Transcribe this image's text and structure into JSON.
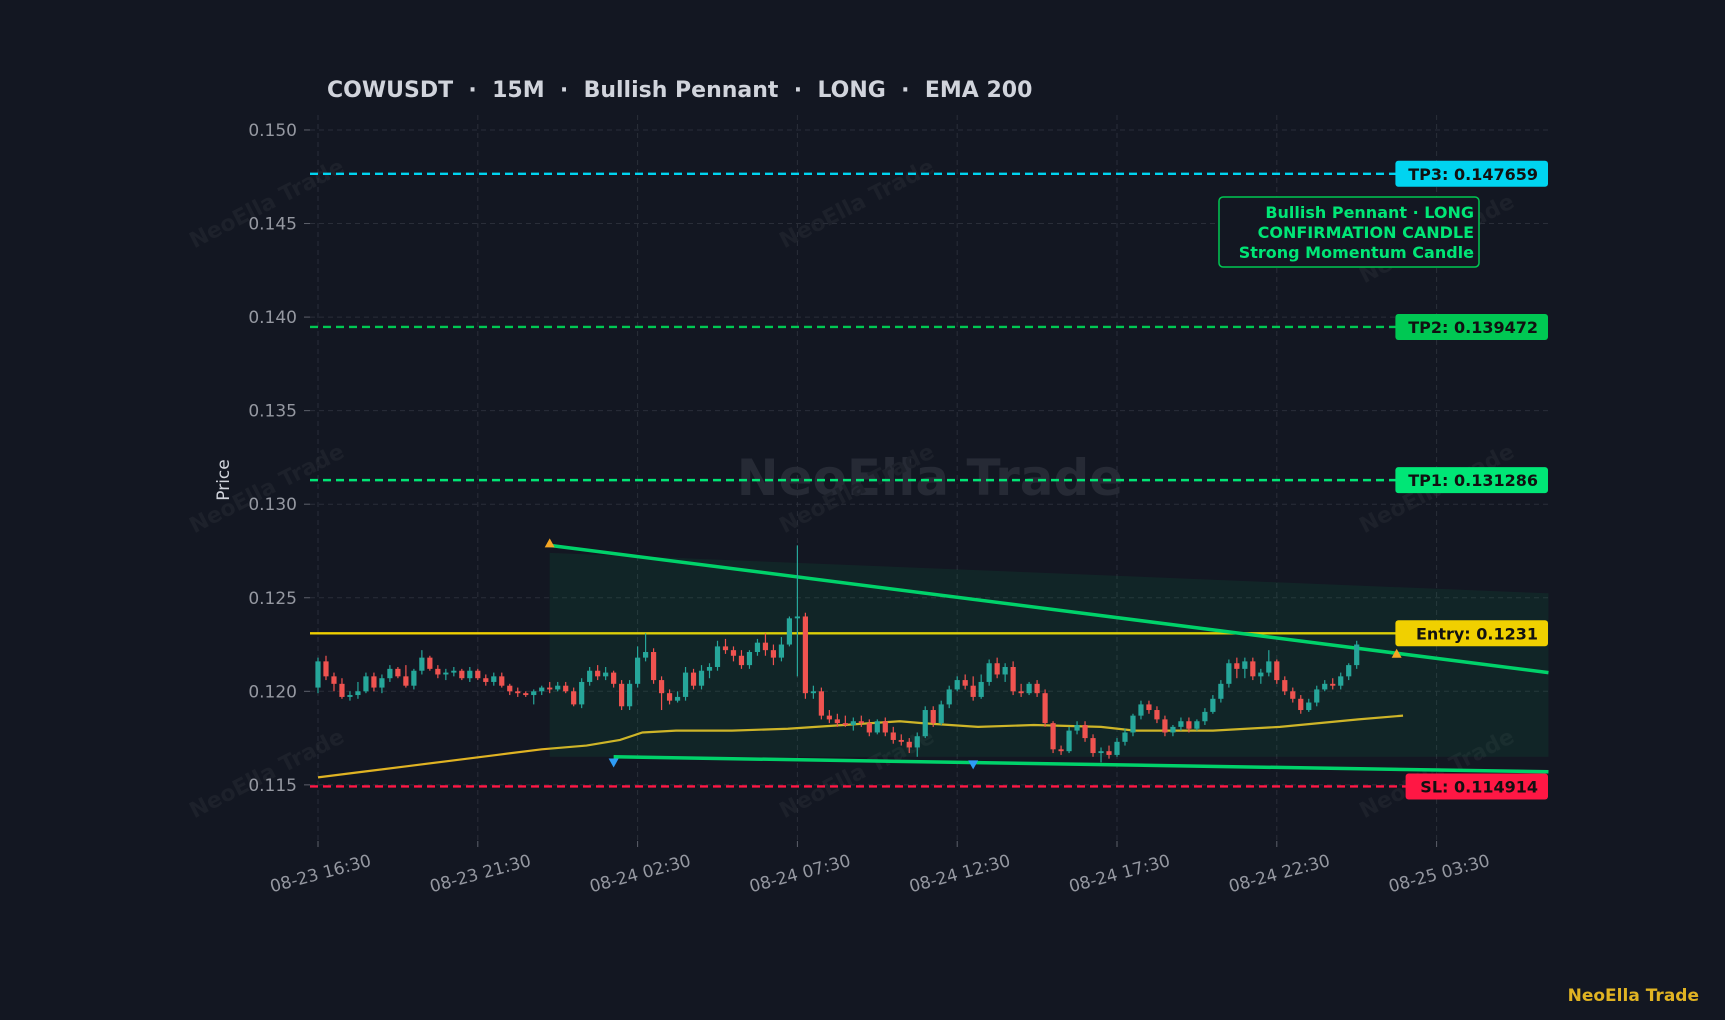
{
  "title": "COWUSDT  ·  15M  ·  Bullish Pennant  ·  LONG  ·  EMA 200",
  "brand": "NeoElla Trade",
  "watermark": "NeoElla Trade",
  "colors": {
    "background": "#131722",
    "grid": "#2a2e39",
    "bull": "#26a69a",
    "bear": "#ef5350",
    "ema": "#e0b323",
    "entry": "#f0d000",
    "tp1": "#00e676",
    "tp2": "#00c853",
    "tp3": "#00d4f0",
    "sl": "#ff1744",
    "pattern": "#00d26a",
    "text": "#9598a1"
  },
  "chart_data": {
    "type": "candlestick",
    "ylabel": "Price",
    "xlabel": "",
    "ylim": [
      0.112,
      0.1508
    ],
    "grid": true,
    "yticks": [
      0.115,
      0.12,
      0.125,
      0.13,
      0.135,
      0.14,
      0.145,
      0.15
    ],
    "xticks": [
      "08-23 16:30",
      "08-23 21:30",
      "08-24 02:30",
      "08-24 07:30",
      "08-24 12:30",
      "08-24 17:30",
      "08-24 22:30",
      "08-25 03:30"
    ],
    "levels": [
      {
        "key": "tp3",
        "label": "TP3: 0.147659",
        "value": 0.147659,
        "style": "dashed"
      },
      {
        "key": "tp2",
        "label": "TP2: 0.139472",
        "value": 0.139472,
        "style": "dashed"
      },
      {
        "key": "tp1",
        "label": "TP1: 0.131286",
        "value": 0.131286,
        "style": "dashed"
      },
      {
        "key": "entry",
        "label": "Entry: 0.1231",
        "value": 0.1231,
        "style": "solid"
      },
      {
        "key": "sl",
        "label": "SL: 0.114914",
        "value": 0.114914,
        "style": "dashed"
      }
    ],
    "annotation": [
      "Bullish Pennant · LONG",
      "CONFIRMATION CANDLE",
      "Strong Momentum Candle"
    ],
    "pattern": {
      "upper": [
        [
          29,
          0.1278
        ],
        [
          154,
          0.121
        ]
      ],
      "lower": [
        [
          37,
          0.1165
        ],
        [
          154,
          0.1157
        ]
      ],
      "zone": [
        [
          29,
          0.1274
        ],
        [
          154,
          0.1165
        ]
      ],
      "pivots": [
        {
          "x": 29,
          "y": 0.1278,
          "type": "high"
        },
        {
          "x": 37,
          "y": 0.1163,
          "type": "low"
        },
        {
          "x": 82,
          "y": 0.1162,
          "type": "low"
        },
        {
          "x": 135,
          "y": 0.1219,
          "type": "high"
        }
      ]
    },
    "ema": [
      [
        0,
        0.1154
      ],
      [
        4,
        0.1157
      ],
      [
        8,
        0.116
      ],
      [
        12,
        0.1163
      ],
      [
        16,
        0.1166
      ],
      [
        20,
        0.1169
      ],
      [
        24,
        0.1171
      ],
      [
        27,
        0.1174
      ],
      [
        29,
        0.1178
      ],
      [
        32,
        0.1179
      ],
      [
        37,
        0.1179
      ],
      [
        42,
        0.118
      ],
      [
        47,
        0.1182
      ],
      [
        52,
        0.1184
      ],
      [
        54,
        0.1183
      ],
      [
        59,
        0.1181
      ],
      [
        64,
        0.1182
      ],
      [
        70,
        0.1181
      ],
      [
        73,
        0.1179
      ],
      [
        80,
        0.1179
      ],
      [
        86,
        0.1181
      ],
      [
        93,
        0.1185
      ],
      [
        97,
        0.1187
      ]
    ],
    "candle_start": "08-23 16:30",
    "candle_interval_minutes": 15,
    "candles": [
      [
        0.1202,
        0.1218,
        0.1199,
        0.1216
      ],
      [
        0.1216,
        0.1219,
        0.1206,
        0.1208
      ],
      [
        0.1208,
        0.121,
        0.12,
        0.1204
      ],
      [
        0.1204,
        0.1207,
        0.1196,
        0.1197
      ],
      [
        0.1197,
        0.12,
        0.1195,
        0.1198
      ],
      [
        0.1198,
        0.1205,
        0.1196,
        0.12
      ],
      [
        0.12,
        0.121,
        0.1199,
        0.1208
      ],
      [
        0.1208,
        0.121,
        0.12,
        0.1202
      ],
      [
        0.1202,
        0.1209,
        0.1199,
        0.1207
      ],
      [
        0.1207,
        0.1214,
        0.1205,
        0.1212
      ],
      [
        0.1212,
        0.1213,
        0.1207,
        0.1208
      ],
      [
        0.1208,
        0.1214,
        0.1202,
        0.1203
      ],
      [
        0.1203,
        0.1212,
        0.1201,
        0.1211
      ],
      [
        0.1211,
        0.1222,
        0.1209,
        0.1218
      ],
      [
        0.1218,
        0.1219,
        0.1211,
        0.1212
      ],
      [
        0.1212,
        0.1214,
        0.1207,
        0.1209
      ],
      [
        0.1209,
        0.1212,
        0.1206,
        0.121
      ],
      [
        0.121,
        0.1213,
        0.1208,
        0.1211
      ],
      [
        0.1211,
        0.1212,
        0.1206,
        0.1207
      ],
      [
        0.1207,
        0.1213,
        0.1205,
        0.1211
      ],
      [
        0.1211,
        0.1212,
        0.1206,
        0.1207
      ],
      [
        0.1207,
        0.1209,
        0.1203,
        0.1205
      ],
      [
        0.1205,
        0.121,
        0.1203,
        0.1208
      ],
      [
        0.1208,
        0.121,
        0.1202,
        0.1203
      ],
      [
        0.1203,
        0.1204,
        0.1198,
        0.12
      ],
      [
        0.12,
        0.1202,
        0.1197,
        0.1199
      ],
      [
        0.1199,
        0.12,
        0.1197,
        0.1198
      ],
      [
        0.1198,
        0.1201,
        0.1193,
        0.12
      ],
      [
        0.12,
        0.1203,
        0.1198,
        0.1202
      ],
      [
        0.1202,
        0.1205,
        0.1199,
        0.1201
      ],
      [
        0.1201,
        0.1205,
        0.12,
        0.1203
      ],
      [
        0.1203,
        0.1205,
        0.1199,
        0.12
      ],
      [
        0.12,
        0.1202,
        0.1192,
        0.1193
      ],
      [
        0.1193,
        0.1207,
        0.1191,
        0.1205
      ],
      [
        0.1205,
        0.1213,
        0.1203,
        0.1211
      ],
      [
        0.1211,
        0.1214,
        0.1206,
        0.1208
      ],
      [
        0.1208,
        0.1213,
        0.1206,
        0.121
      ],
      [
        0.121,
        0.1211,
        0.1202,
        0.1204
      ],
      [
        0.1204,
        0.1206,
        0.119,
        0.1192
      ],
      [
        0.1192,
        0.1206,
        0.119,
        0.1204
      ],
      [
        0.1204,
        0.1224,
        0.1202,
        0.1218
      ],
      [
        0.1218,
        0.1231,
        0.1216,
        0.1221
      ],
      [
        0.1221,
        0.1223,
        0.1204,
        0.1206
      ],
      [
        0.1206,
        0.1208,
        0.119,
        0.1199
      ],
      [
        0.1199,
        0.1201,
        0.1193,
        0.1195
      ],
      [
        0.1195,
        0.12,
        0.1194,
        0.1197
      ],
      [
        0.1197,
        0.1213,
        0.1195,
        0.121
      ],
      [
        0.121,
        0.1212,
        0.1201,
        0.1203
      ],
      [
        0.1203,
        0.1214,
        0.1201,
        0.1211
      ],
      [
        0.1211,
        0.1215,
        0.1207,
        0.1213
      ],
      [
        0.1213,
        0.1227,
        0.1211,
        0.1224
      ],
      [
        0.1224,
        0.1228,
        0.122,
        0.1222
      ],
      [
        0.1222,
        0.1224,
        0.1216,
        0.1219
      ],
      [
        0.1219,
        0.1222,
        0.1212,
        0.1214
      ],
      [
        0.1214,
        0.1222,
        0.1212,
        0.1221
      ],
      [
        0.1221,
        0.1228,
        0.1219,
        0.1226
      ],
      [
        0.1226,
        0.1231,
        0.1219,
        0.1222
      ],
      [
        0.1222,
        0.1225,
        0.1214,
        0.1218
      ],
      [
        0.1218,
        0.1229,
        0.1216,
        0.1225
      ],
      [
        0.1225,
        0.124,
        0.1224,
        0.1239
      ],
      [
        0.1239,
        0.1278,
        0.1208,
        0.124
      ],
      [
        0.124,
        0.1242,
        0.1196,
        0.1199
      ],
      [
        0.1199,
        0.1203,
        0.1196,
        0.12
      ],
      [
        0.12,
        0.1202,
        0.1185,
        0.1187
      ],
      [
        0.1187,
        0.119,
        0.1183,
        0.1185
      ],
      [
        0.1185,
        0.1188,
        0.1181,
        0.1183
      ],
      [
        0.1183,
        0.1187,
        0.1181,
        0.1182
      ],
      [
        0.1182,
        0.1186,
        0.1179,
        0.1184
      ],
      [
        0.1184,
        0.1187,
        0.1181,
        0.1183
      ],
      [
        0.1183,
        0.1185,
        0.1176,
        0.1178
      ],
      [
        0.1178,
        0.1185,
        0.1177,
        0.1184
      ],
      [
        0.1184,
        0.1186,
        0.1176,
        0.1178
      ],
      [
        0.1178,
        0.1181,
        0.1172,
        0.1174
      ],
      [
        0.1174,
        0.1177,
        0.1171,
        0.1173
      ],
      [
        0.1173,
        0.1175,
        0.1167,
        0.117
      ],
      [
        0.117,
        0.1178,
        0.1165,
        0.1176
      ],
      [
        0.1176,
        0.1192,
        0.1175,
        0.119
      ],
      [
        0.119,
        0.1192,
        0.1181,
        0.1183
      ],
      [
        0.1183,
        0.1195,
        0.1182,
        0.1193
      ],
      [
        0.1193,
        0.1203,
        0.1191,
        0.1201
      ],
      [
        0.1201,
        0.1208,
        0.12,
        0.1206
      ],
      [
        0.1206,
        0.1209,
        0.1201,
        0.1203
      ],
      [
        0.1203,
        0.1208,
        0.1195,
        0.1197
      ],
      [
        0.1197,
        0.1209,
        0.1196,
        0.1205
      ],
      [
        0.1205,
        0.1217,
        0.1203,
        0.1215
      ],
      [
        0.1215,
        0.1218,
        0.1207,
        0.1209
      ],
      [
        0.1209,
        0.1215,
        0.1205,
        0.1213
      ],
      [
        0.1213,
        0.1216,
        0.1198,
        0.12
      ],
      [
        0.12,
        0.1204,
        0.1197,
        0.1199
      ],
      [
        0.1199,
        0.1205,
        0.1198,
        0.1204
      ],
      [
        0.1204,
        0.1206,
        0.1197,
        0.1199
      ],
      [
        0.1199,
        0.1201,
        0.1181,
        0.1183
      ],
      [
        0.1183,
        0.1184,
        0.1167,
        0.1169
      ],
      [
        0.1169,
        0.1171,
        0.1166,
        0.1168
      ],
      [
        0.1168,
        0.1181,
        0.1167,
        0.1179
      ],
      [
        0.1179,
        0.1184,
        0.1177,
        0.1182
      ],
      [
        0.1182,
        0.1184,
        0.1173,
        0.1175
      ],
      [
        0.1175,
        0.1177,
        0.1165,
        0.1167
      ],
      [
        0.1167,
        0.117,
        0.1162,
        0.1168
      ],
      [
        0.1168,
        0.1171,
        0.1164,
        0.1166
      ],
      [
        0.1166,
        0.1175,
        0.1165,
        0.1173
      ],
      [
        0.1173,
        0.118,
        0.1171,
        0.1178
      ],
      [
        0.1178,
        0.1188,
        0.1176,
        0.1187
      ],
      [
        0.1187,
        0.1195,
        0.1185,
        0.1193
      ],
      [
        0.1193,
        0.1195,
        0.1188,
        0.119
      ],
      [
        0.119,
        0.1192,
        0.1183,
        0.1185
      ],
      [
        0.1185,
        0.1187,
        0.1176,
        0.1178
      ],
      [
        0.1178,
        0.1182,
        0.1176,
        0.1181
      ],
      [
        0.1181,
        0.1186,
        0.1179,
        0.1184
      ],
      [
        0.1184,
        0.1186,
        0.1178,
        0.118
      ],
      [
        0.118,
        0.1185,
        0.1179,
        0.1184
      ],
      [
        0.1184,
        0.1191,
        0.1182,
        0.1189
      ],
      [
        0.1189,
        0.1198,
        0.1188,
        0.1196
      ],
      [
        0.1196,
        0.1206,
        0.1194,
        0.1204
      ],
      [
        0.1204,
        0.1217,
        0.1202,
        0.1215
      ],
      [
        0.1215,
        0.1218,
        0.1207,
        0.1212
      ],
      [
        0.1212,
        0.1218,
        0.1207,
        0.1216
      ],
      [
        0.1216,
        0.1218,
        0.1206,
        0.1208
      ],
      [
        0.1208,
        0.1212,
        0.1204,
        0.121
      ],
      [
        0.121,
        0.1222,
        0.1208,
        0.1216
      ],
      [
        0.1216,
        0.1217,
        0.1204,
        0.1206
      ],
      [
        0.1206,
        0.1208,
        0.1198,
        0.12
      ],
      [
        0.12,
        0.1202,
        0.1194,
        0.1196
      ],
      [
        0.1196,
        0.1198,
        0.1188,
        0.119
      ],
      [
        0.119,
        0.1196,
        0.1189,
        0.1194
      ],
      [
        0.1194,
        0.1203,
        0.1192,
        0.1201
      ],
      [
        0.1201,
        0.1206,
        0.12,
        0.1204
      ],
      [
        0.1204,
        0.1207,
        0.1201,
        0.1203
      ],
      [
        0.1203,
        0.121,
        0.1201,
        0.1208
      ],
      [
        0.1208,
        0.1215,
        0.1206,
        0.1214
      ],
      [
        0.1214,
        0.1227,
        0.1212,
        0.1225
      ]
    ]
  }
}
